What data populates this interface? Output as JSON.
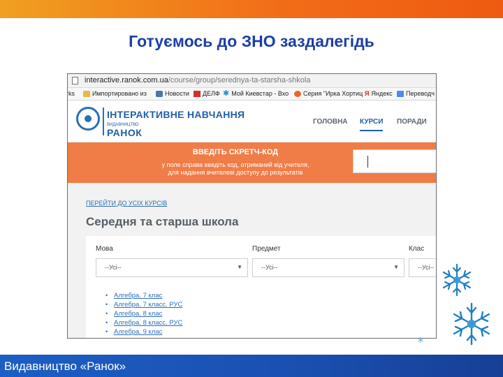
{
  "slide": {
    "title": "Готуємось до ЗНО заздалегідь",
    "footer": "Видавництво «Ранок»",
    "colors": {
      "top_bar": "#f26d18",
      "bottom_bar": "#1a4fb0",
      "title": "#1c3ea8"
    }
  },
  "browser": {
    "url_host": "interactive.ranok.com.ua",
    "url_path": "/course/group/serednya-ta-starsha-shkola",
    "bookmarks": [
      {
        "label": "rks",
        "icon": "bookmark-icon"
      },
      {
        "label": "Импортировано из",
        "icon": "folder-icon"
      },
      {
        "label": "Новости",
        "icon": "vk-icon"
      },
      {
        "label": "ДЕЛФ",
        "icon": "tile-icon"
      },
      {
        "label": "Мой Киевстар - Вхо",
        "icon": "kyivstar-icon"
      },
      {
        "label": "Серия \"Ирка Хортиц",
        "icon": "globe-icon"
      },
      {
        "label": "Яндекс",
        "icon": "yandex-icon"
      },
      {
        "label": "Переводч",
        "icon": "translate-icon"
      }
    ]
  },
  "site": {
    "logo_main": "ІНТЕРАКТИВНЕ НАВЧАННЯ",
    "logo_sub": "ВИДАВНИЦТВО",
    "logo_brand": "РАНОК",
    "nav": [
      "ГОЛОВНА",
      "КУРСИ",
      "ПОРАДИ"
    ],
    "nav_active": "КУРСИ",
    "promo": {
      "title": "ВВЕДІТЬ СКРЕТЧ-КОД",
      "line1": "у поле справа введіть код, отриманий від учителя,",
      "line2": "для надання вчителеві доступу до результатів",
      "input_value": ""
    },
    "back_link": "ПЕРЕЙТИ ДО УСІХ КУРСІВ",
    "heading": "Середня та старша школа",
    "filters": [
      {
        "label": "Мова",
        "value": "--Усі--"
      },
      {
        "label": "Предмет",
        "value": "--Усі--"
      },
      {
        "label": "Клас",
        "value": "--Усі--"
      }
    ],
    "courses": [
      "Алгебра. 7 клас",
      "Алгебра. 7 класс. РУС",
      "Алгебра. 8 клас",
      "Алгебра. 8 класс. РУС",
      "Алгебра. 9 клас"
    ]
  }
}
